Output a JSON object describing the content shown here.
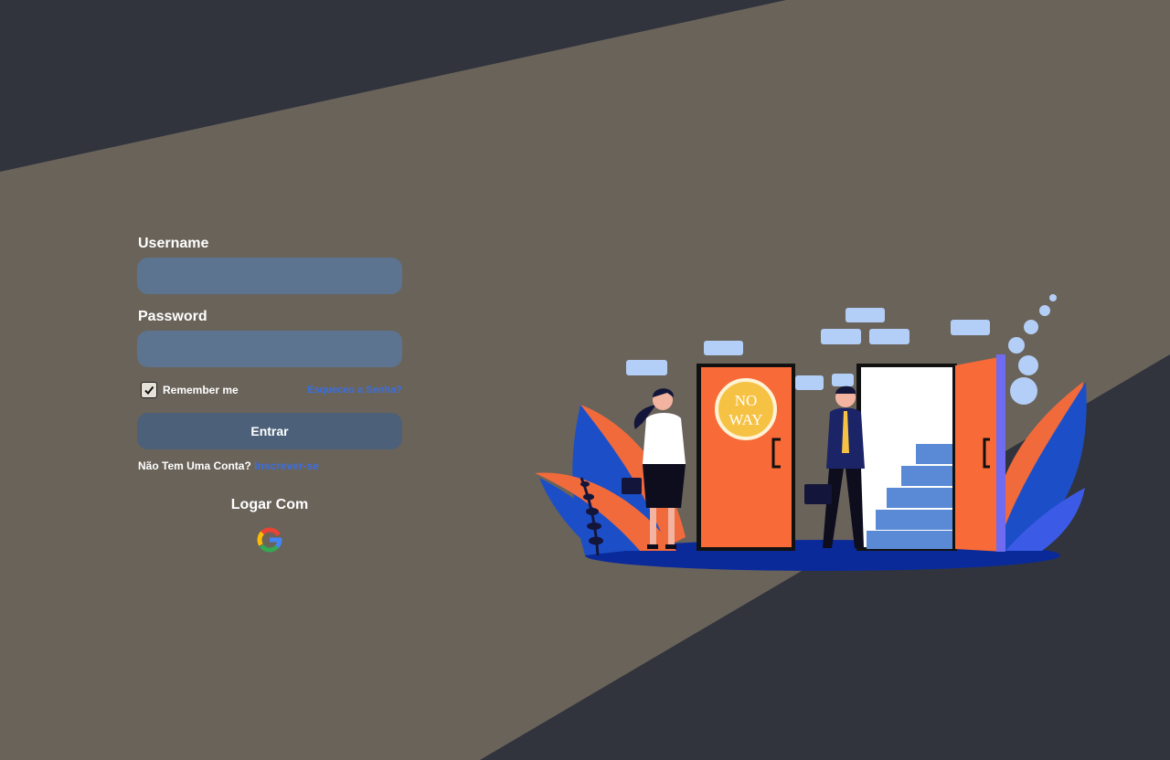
{
  "login": {
    "username_label": "Username",
    "password_label": "Password",
    "remember_label": "Remember me",
    "forgot_label": "Esqueceu a Senha?",
    "submit_label": "Entrar",
    "no_account_text": "Não Tem Uma Conta?",
    "signup_link": "Inscrever-se",
    "social_title": "Logar Com"
  },
  "illustration": {
    "sign_line1": "NO",
    "sign_line2": "WAY"
  },
  "colors": {
    "background": "#6a635a",
    "dark_band": "#31343d",
    "input": "#5d7491",
    "button": "#4c6079",
    "link": "#3a6fe0"
  }
}
